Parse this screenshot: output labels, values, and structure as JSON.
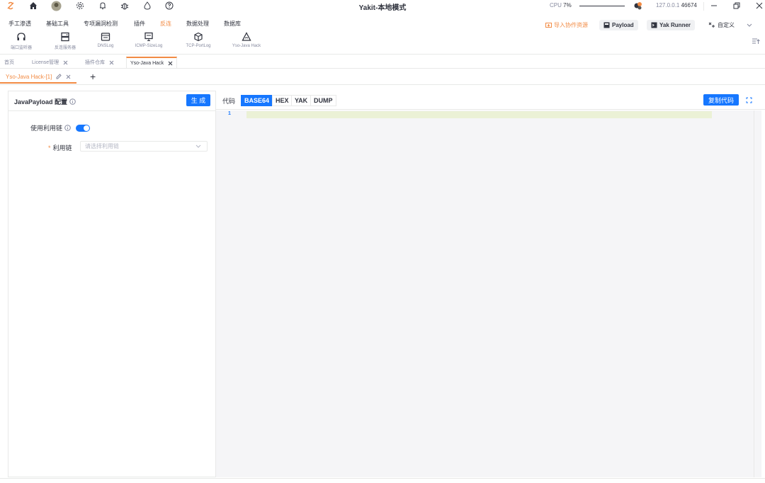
{
  "titlebar": {
    "app_title": "Yakit-本地模式",
    "cpu_label": "CPU",
    "cpu_value": "7%",
    "host": "127.0.0.1",
    "port": "46674"
  },
  "menu": {
    "items": [
      "手工渗透",
      "基础工具",
      "专项漏洞检测",
      "插件",
      "反连",
      "数据处理",
      "数据库"
    ],
    "active_index": 4,
    "import_label": "导入协作资源",
    "payload_label": "Payload",
    "yak_runner_label": "Yak Runner",
    "customize_label": "自定义"
  },
  "toolbar": {
    "tools": [
      {
        "label": "端口监听器",
        "icon": "headset-icon"
      },
      {
        "label": "反连服务器",
        "icon": "server-icon"
      },
      {
        "label": "DNSLog",
        "icon": "dnslog-icon"
      },
      {
        "label": "ICMP-SizeLog",
        "icon": "monitor-icon"
      },
      {
        "label": "TCP-PortLog",
        "icon": "box-icon"
      },
      {
        "label": "Yso-Java Hack",
        "icon": "java-icon"
      }
    ]
  },
  "tabs": {
    "page_tabs": [
      "首页",
      "License管理",
      "插件仓库",
      "Yso-Java Hack"
    ],
    "active_page_tab": 3,
    "sub_tab": "Yso-Java Hack-[1]",
    "add_label": "+"
  },
  "config": {
    "title": "JavaPayload 配置",
    "generate_label": "生 成",
    "use_chain_label": "使用利用链",
    "use_chain_enabled": true,
    "chain_label": "利用链",
    "chain_placeholder": "请选择利用链"
  },
  "code": {
    "label": "代码",
    "formats": [
      "BASE64",
      "HEX",
      "YAK",
      "DUMP"
    ],
    "active_format": 0,
    "copy_label": "复制代码",
    "line_number": "1"
  },
  "colors": {
    "accent": "#f28b44",
    "primary": "#1677ff",
    "line_highlight": "#ebf1d6"
  }
}
